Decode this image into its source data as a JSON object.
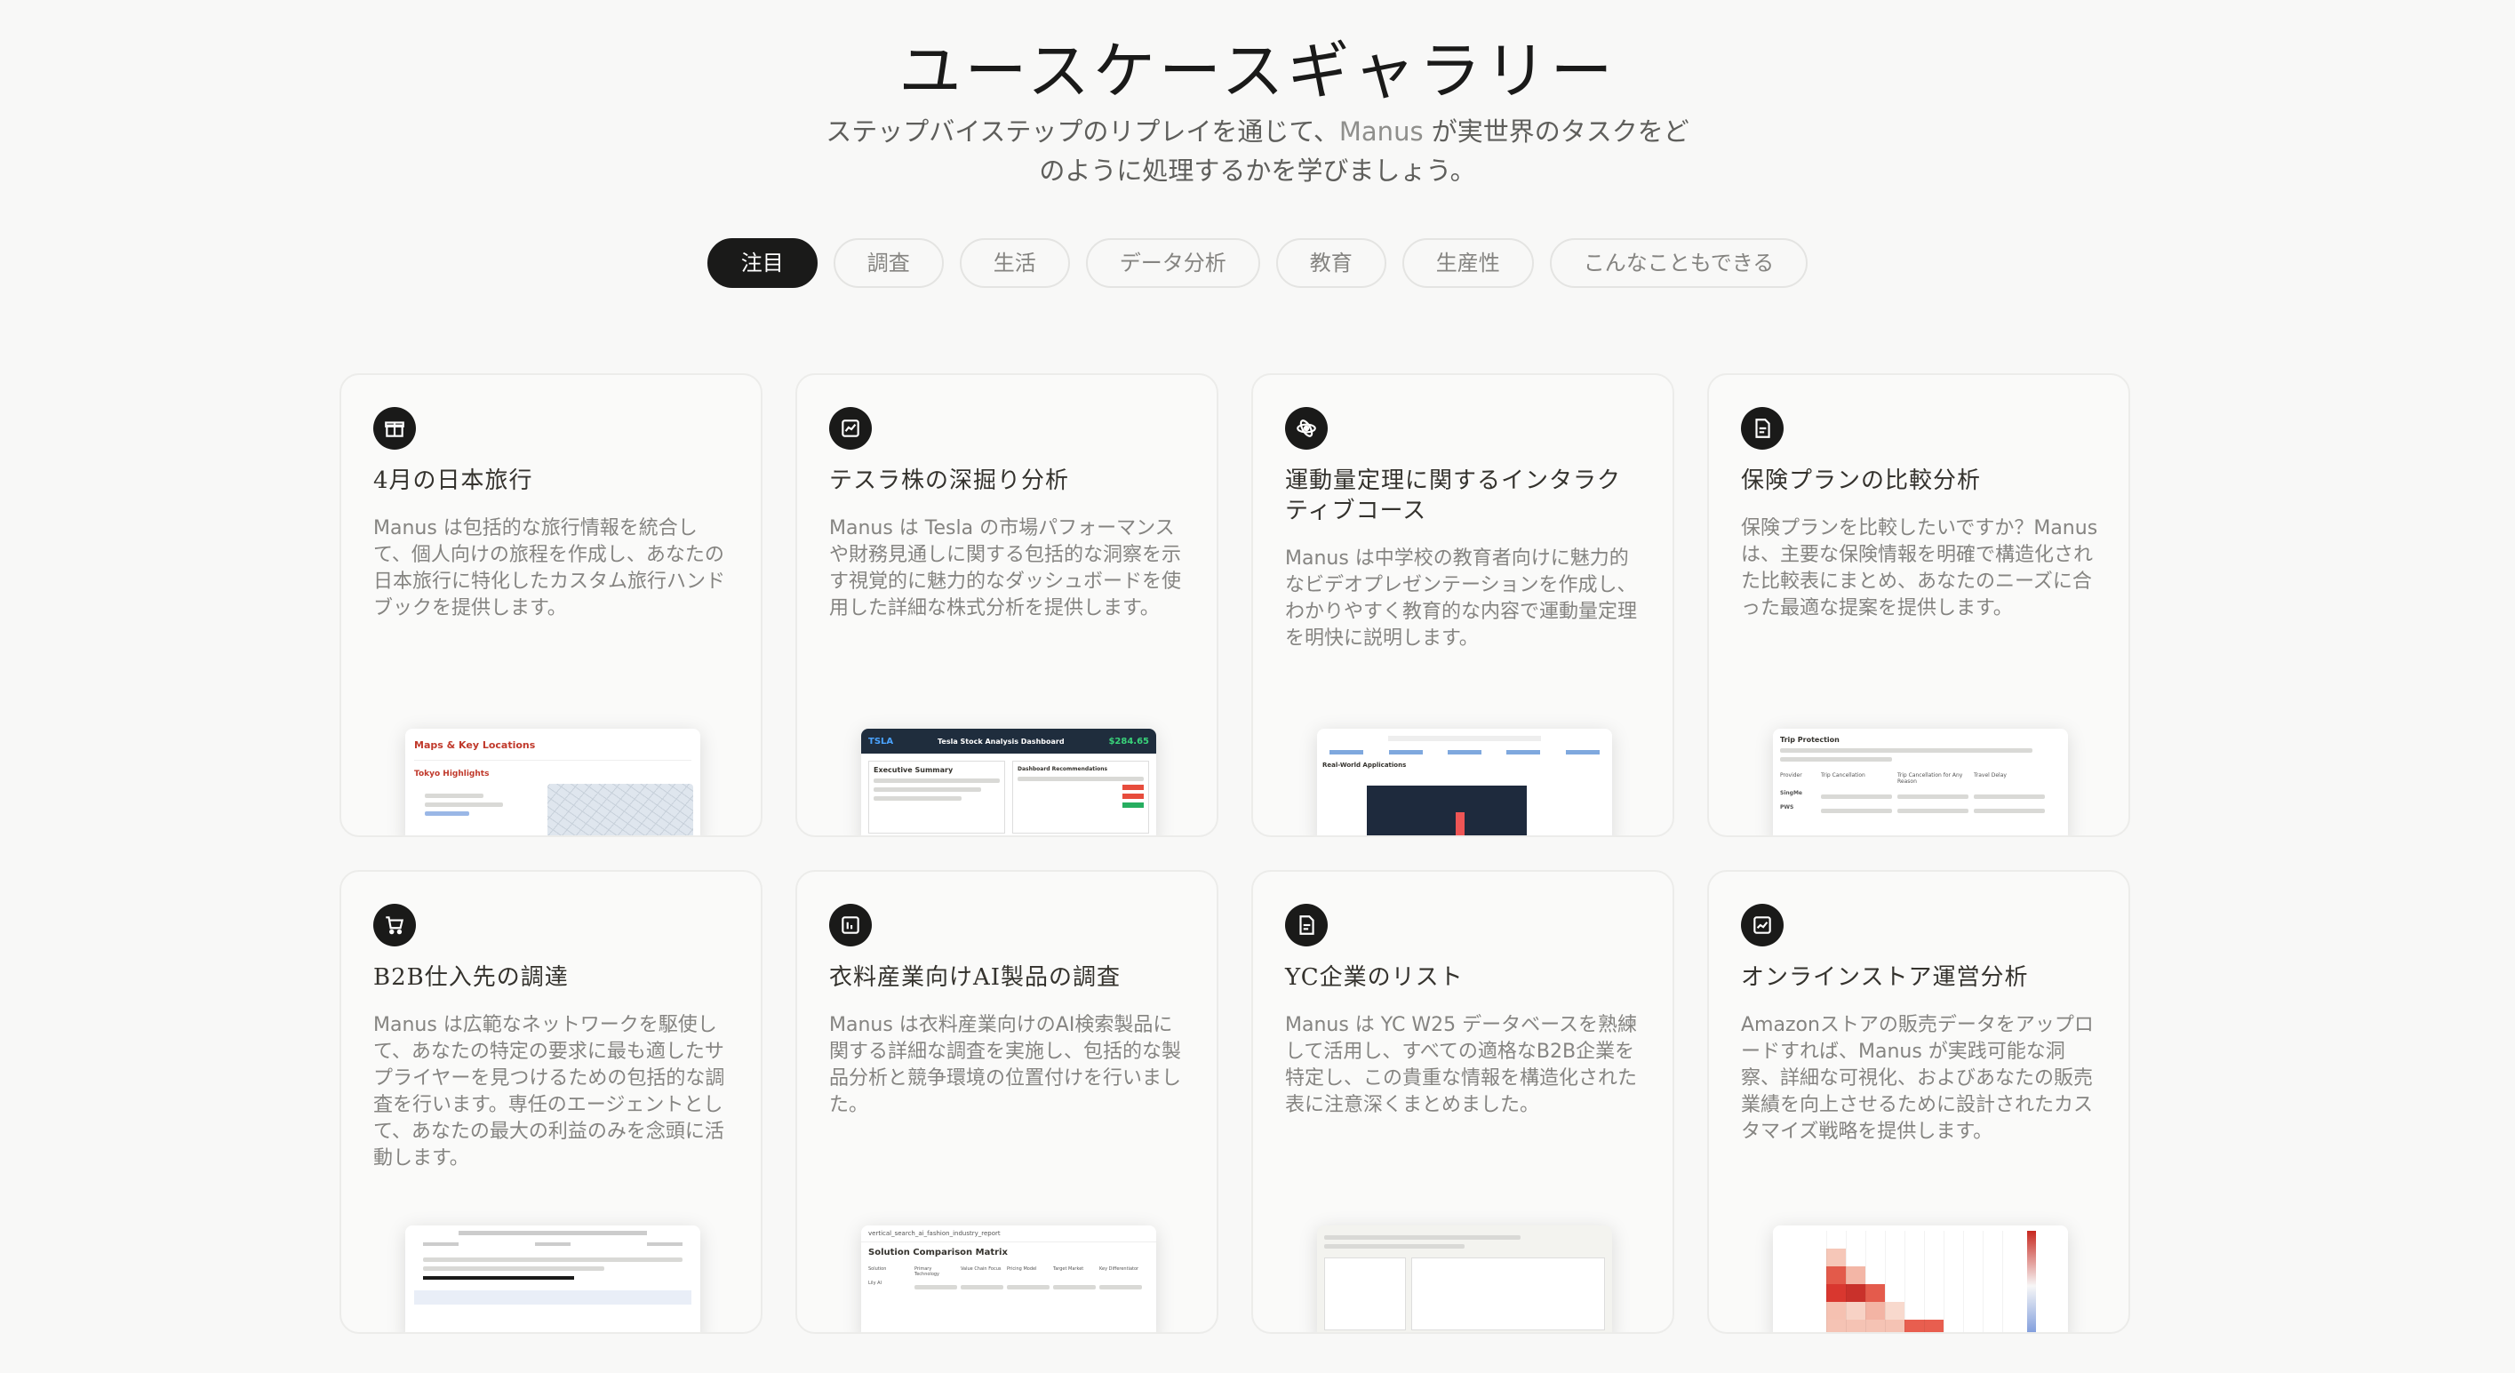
{
  "header": {
    "title": "ユースケースギャラリー",
    "subtitle_line1_before": "ステップバイステップのリプレイを通じて、",
    "subtitle_brand": "Manus",
    "subtitle_line1_after": "が実世界のタスクをど",
    "subtitle_line2": "のように処理するかを学びましょう。"
  },
  "tabs": [
    {
      "label": "注目",
      "active": true
    },
    {
      "label": "調査",
      "active": false
    },
    {
      "label": "生活",
      "active": false
    },
    {
      "label": "データ分析",
      "active": false
    },
    {
      "label": "教育",
      "active": false
    },
    {
      "label": "生産性",
      "active": false
    },
    {
      "label": "こんなこともできる",
      "active": false
    }
  ],
  "cards": [
    {
      "icon": "gift-icon",
      "title": "4月の日本旅行",
      "desc": "Manus は包括的な旅行情報を統合して、個人向けの旅程を作成し、あなたの日本旅行に特化したカスタム旅行ハンドブックを提供します。",
      "preview": {
        "heading": "Maps & Key Locations",
        "sub": "Tokyo Highlights"
      }
    },
    {
      "icon": "chart-box-icon",
      "title": "テスラ株の深掘り分析",
      "desc": "Manus は Tesla の市場パフォーマンスや財務見通しに関する包括的な洞察を示す視覚的に魅力的なダッシュボードを使用した詳細な株式分析を提供します。",
      "preview": {
        "ticker": "TSLA",
        "heading": "Tesla Stock Analysis Dashboard",
        "price": "$284.65",
        "sub": "Executive Summary",
        "sub2": "Dashboard Recommendations"
      }
    },
    {
      "icon": "atom-icon",
      "title": "運動量定理に関するインタラクティブコース",
      "desc": "Manus は中学校の教育者向けに魅力的なビデオプレゼンテーションを作成し、わかりやすく教育的な内容で運動量定理を明快に説明します。",
      "preview": {
        "sub": "Real-World Applications"
      }
    },
    {
      "icon": "document-icon",
      "title": "保険プランの比較分析",
      "desc": "保険プランを比較したいですか？Manus は、主要な保険情報を明確で構造化された比較表にまとめ、あなたのニーズに合った最適な提案を提供します。",
      "preview": {
        "heading": "Trip Protection",
        "col1": "Provider",
        "col2": "Trip Cancellation",
        "col3": "Trip Cancellation for Any Reason",
        "col4": "Travel Delay",
        "row1": "SingMe",
        "row2": "PWS"
      }
    },
    {
      "icon": "cart-icon",
      "title": "B2B仕入先の調達",
      "desc": "Manus は広範なネットワークを駆使して、あなたの特定の要求に最も適したサプライヤーを見つけるための包括的な調査を行います。専任のエージェントとして、あなたの最大の利益のみを念頭に活動します。",
      "preview": {}
    },
    {
      "icon": "report-icon",
      "title": "衣料産業向けAI製品の調査",
      "desc": "Manus は衣料産業向けのAI検索製品に関する詳細な調査を実施し、包括的な製品分析と競争環境の位置付けを行いました。",
      "preview": {
        "file": "vertical_search_ai_fashion_industry_report",
        "heading": "Solution Comparison Matrix",
        "col1": "Solution",
        "col2": "Primary Technology",
        "col3": "Value Chain Focus",
        "col4": "Pricing Model",
        "col5": "Target Market",
        "col6": "Key Differentiator",
        "row1": "Lily AI"
      }
    },
    {
      "icon": "document-icon",
      "title": "YC企業のリスト",
      "desc": "Manus は YC W25 データベースを熟練して活用し、すべての適格なB2B企業を特定し、この貴重な情報を構造化された表に注意深くまとめました。",
      "preview": {}
    },
    {
      "icon": "analytics-icon",
      "title": "オンラインストア運営分析",
      "desc": "Amazonストアの販売データをアップロードすれば、Manus が実践可能な洞察、詳細な可視化、およびあなたの販売業績を向上させるために設計されたカスタマイズ戦略を提供します。",
      "preview": {}
    }
  ]
}
